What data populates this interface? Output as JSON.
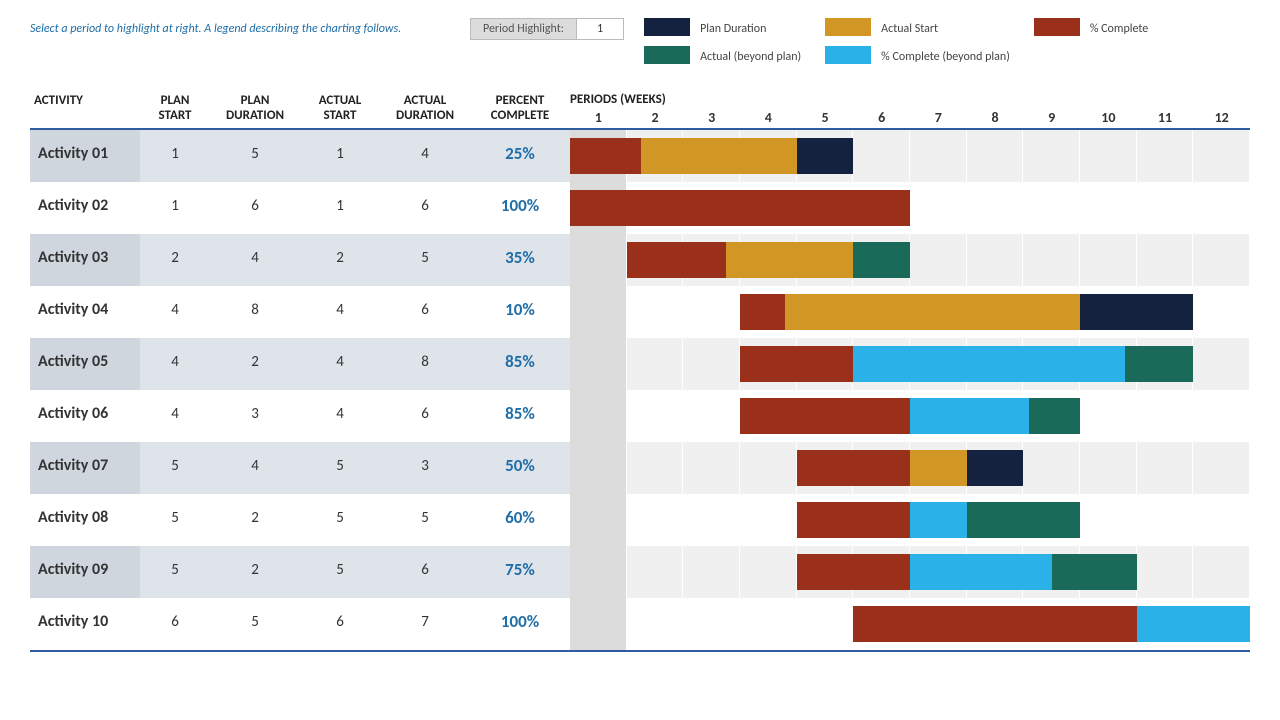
{
  "instruction": "Select a period to highlight at right.  A legend describing the charting follows.",
  "period_highlight_label": "Period Highlight:",
  "period_highlight_value": "1",
  "legend": {
    "plan": "Plan Duration",
    "actual_start": "Actual Start",
    "complete": "% Complete",
    "actual_beyond": "Actual (beyond plan)",
    "complete_beyond": "% Complete (beyond plan)"
  },
  "columns": {
    "activity": "ACTIVITY",
    "plan_start": "PLAN START",
    "plan_duration": "PLAN DURATION",
    "actual_start": "ACTUAL START",
    "actual_duration": "ACTUAL DURATION",
    "percent_complete": "PERCENT COMPLETE",
    "periods_title": "PERIODS (WEEKS)"
  },
  "num_periods": 12,
  "highlight_period": 1,
  "activities": [
    {
      "name": "Activity 01",
      "plan_start": 1,
      "plan_duration": 5,
      "actual_start": 1,
      "actual_duration": 4,
      "percent_complete": 25
    },
    {
      "name": "Activity 02",
      "plan_start": 1,
      "plan_duration": 6,
      "actual_start": 1,
      "actual_duration": 6,
      "percent_complete": 100
    },
    {
      "name": "Activity 03",
      "plan_start": 2,
      "plan_duration": 4,
      "actual_start": 2,
      "actual_duration": 5,
      "percent_complete": 35
    },
    {
      "name": "Activity 04",
      "plan_start": 4,
      "plan_duration": 8,
      "actual_start": 4,
      "actual_duration": 6,
      "percent_complete": 10
    },
    {
      "name": "Activity 05",
      "plan_start": 4,
      "plan_duration": 2,
      "actual_start": 4,
      "actual_duration": 8,
      "percent_complete": 85
    },
    {
      "name": "Activity 06",
      "plan_start": 4,
      "plan_duration": 3,
      "actual_start": 4,
      "actual_duration": 6,
      "percent_complete": 85
    },
    {
      "name": "Activity 07",
      "plan_start": 5,
      "plan_duration": 4,
      "actual_start": 5,
      "actual_duration": 3,
      "percent_complete": 50
    },
    {
      "name": "Activity 08",
      "plan_start": 5,
      "plan_duration": 2,
      "actual_start": 5,
      "actual_duration": 5,
      "percent_complete": 60
    },
    {
      "name": "Activity 09",
      "plan_start": 5,
      "plan_duration": 2,
      "actual_start": 5,
      "actual_duration": 6,
      "percent_complete": 75
    },
    {
      "name": "Activity 10",
      "plan_start": 6,
      "plan_duration": 5,
      "actual_start": 6,
      "actual_duration": 7,
      "percent_complete": 100
    }
  ],
  "colors": {
    "plan": "#14213f",
    "actual_start": "#d19623",
    "complete": "#9a2f1a",
    "actual_beyond": "#1a6a5a",
    "complete_beyond": "#2ab1e8"
  },
  "chart_data": {
    "type": "gantt",
    "x_unit": "week",
    "x_range": [
      1,
      12
    ],
    "series_meta": [
      {
        "id": "plan",
        "label": "Plan Duration",
        "color": "#14213f"
      },
      {
        "id": "actual",
        "label": "Actual Start",
        "color": "#d19623"
      },
      {
        "id": "complete",
        "label": "% Complete",
        "color": "#9a2f1a"
      },
      {
        "id": "actual_beyond",
        "label": "Actual (beyond plan)",
        "color": "#1a6a5a"
      },
      {
        "id": "complete_beyond",
        "label": "% Complete (beyond plan)",
        "color": "#2ab1e8"
      }
    ],
    "rows": [
      {
        "name": "Activity 01",
        "plan": [
          1,
          5
        ],
        "actual": [
          1,
          4
        ],
        "pct_complete": 25
      },
      {
        "name": "Activity 02",
        "plan": [
          1,
          6
        ],
        "actual": [
          1,
          6
        ],
        "pct_complete": 100
      },
      {
        "name": "Activity 03",
        "plan": [
          2,
          5
        ],
        "actual": [
          2,
          6
        ],
        "pct_complete": 35
      },
      {
        "name": "Activity 04",
        "plan": [
          4,
          11
        ],
        "actual": [
          4,
          9
        ],
        "pct_complete": 10
      },
      {
        "name": "Activity 05",
        "plan": [
          4,
          5
        ],
        "actual": [
          4,
          11
        ],
        "pct_complete": 85
      },
      {
        "name": "Activity 06",
        "plan": [
          4,
          6
        ],
        "actual": [
          4,
          9
        ],
        "pct_complete": 85
      },
      {
        "name": "Activity 07",
        "plan": [
          5,
          8
        ],
        "actual": [
          5,
          7
        ],
        "pct_complete": 50
      },
      {
        "name": "Activity 08",
        "plan": [
          5,
          6
        ],
        "actual": [
          5,
          9
        ],
        "pct_complete": 60
      },
      {
        "name": "Activity 09",
        "plan": [
          5,
          6
        ],
        "actual": [
          5,
          10
        ],
        "pct_complete": 75
      },
      {
        "name": "Activity 10",
        "plan": [
          6,
          10
        ],
        "actual": [
          6,
          12
        ],
        "pct_complete": 100
      }
    ]
  }
}
